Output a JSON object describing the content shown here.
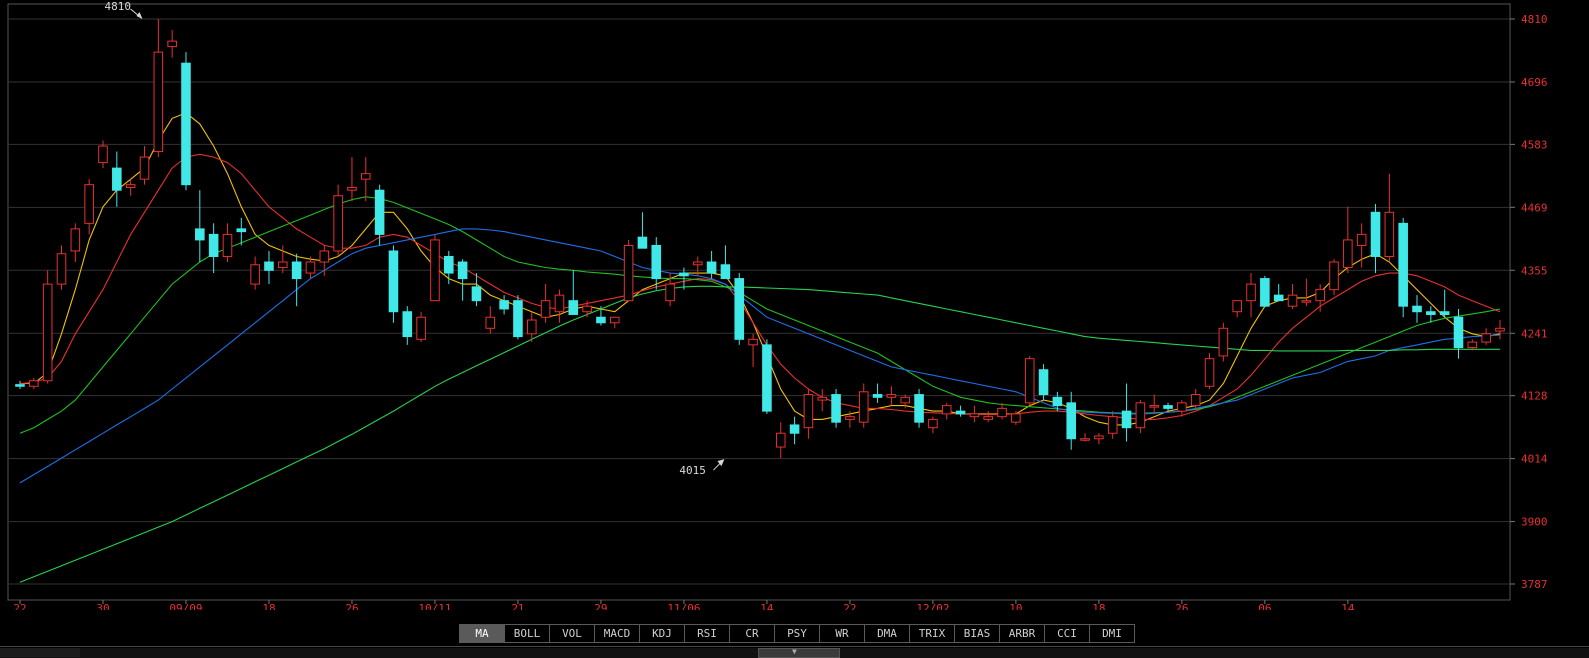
{
  "chart_data": {
    "type": "candlestick",
    "y_ticks": [
      4810,
      4696,
      4583,
      4469,
      4355,
      4241,
      4128,
      4014,
      3900,
      3787
    ],
    "ylim": [
      3787,
      4810
    ],
    "x_ticks": [
      {
        "i": 0,
        "label": "22"
      },
      {
        "i": 6,
        "label": "30"
      },
      {
        "i": 12,
        "label": "09/09"
      },
      {
        "i": 18,
        "label": "18"
      },
      {
        "i": 24,
        "label": "26"
      },
      {
        "i": 30,
        "label": "10/11"
      },
      {
        "i": 36,
        "label": "21"
      },
      {
        "i": 42,
        "label": "29"
      },
      {
        "i": 48,
        "label": "11/06"
      },
      {
        "i": 54,
        "label": "14"
      },
      {
        "i": 60,
        "label": "22"
      },
      {
        "i": 66,
        "label": "12/02"
      },
      {
        "i": 72,
        "label": "10"
      },
      {
        "i": 78,
        "label": "18"
      },
      {
        "i": 84,
        "label": "26"
      },
      {
        "i": 90,
        "label": "06"
      },
      {
        "i": 96,
        "label": "14"
      }
    ],
    "annotations": [
      {
        "label": "4810",
        "index": 9,
        "value": 4810,
        "kind": "high"
      },
      {
        "label": "4015",
        "index": 51,
        "value": 4015,
        "kind": "low"
      }
    ],
    "candles": [
      [
        4148,
        4155,
        4140,
        4145
      ],
      [
        4145,
        4160,
        4140,
        4155
      ],
      [
        4155,
        4355,
        4150,
        4330
      ],
      [
        4330,
        4400,
        4320,
        4385
      ],
      [
        4390,
        4440,
        4370,
        4430
      ],
      [
        4440,
        4520,
        4420,
        4510
      ],
      [
        4550,
        4590,
        4540,
        4580
      ],
      [
        4540,
        4570,
        4470,
        4500
      ],
      [
        4505,
        4520,
        4490,
        4510
      ],
      [
        4520,
        4580,
        4510,
        4560
      ],
      [
        4570,
        4810,
        4560,
        4750
      ],
      [
        4760,
        4790,
        4740,
        4770
      ],
      [
        4730,
        4750,
        4500,
        4510
      ],
      [
        4430,
        4500,
        4370,
        4410
      ],
      [
        4420,
        4440,
        4350,
        4380
      ],
      [
        4380,
        4440,
        4370,
        4420
      ],
      [
        4430,
        4450,
        4400,
        4425
      ],
      [
        4330,
        4380,
        4320,
        4365
      ],
      [
        4370,
        4390,
        4330,
        4355
      ],
      [
        4360,
        4400,
        4350,
        4370
      ],
      [
        4370,
        4385,
        4290,
        4340
      ],
      [
        4350,
        4380,
        4340,
        4370
      ],
      [
        4370,
        4400,
        4345,
        4390
      ],
      [
        4390,
        4510,
        4380,
        4490
      ],
      [
        4500,
        4560,
        4480,
        4505
      ],
      [
        4520,
        4560,
        4480,
        4530
      ],
      [
        4500,
        4510,
        4400,
        4420
      ],
      [
        4390,
        4400,
        4260,
        4280
      ],
      [
        4280,
        4290,
        4220,
        4235
      ],
      [
        4230,
        4280,
        4225,
        4270
      ],
      [
        4300,
        4420,
        4300,
        4410
      ],
      [
        4380,
        4390,
        4330,
        4350
      ],
      [
        4370,
        4375,
        4300,
        4340
      ],
      [
        4325,
        4350,
        4290,
        4300
      ],
      [
        4250,
        4290,
        4240,
        4270
      ],
      [
        4300,
        4310,
        4275,
        4285
      ],
      [
        4300,
        4310,
        4230,
        4235
      ],
      [
        4240,
        4280,
        4225,
        4265
      ],
      [
        4270,
        4330,
        4260,
        4300
      ],
      [
        4280,
        4320,
        4260,
        4310
      ],
      [
        4300,
        4355,
        4280,
        4275
      ],
      [
        4280,
        4300,
        4270,
        4290
      ],
      [
        4270,
        4290,
        4255,
        4260
      ],
      [
        4260,
        4270,
        4250,
        4270
      ],
      [
        4300,
        4410,
        4300,
        4400
      ],
      [
        4415,
        4460,
        4400,
        4395
      ],
      [
        4400,
        4415,
        4320,
        4340
      ],
      [
        4300,
        4350,
        4290,
        4330
      ],
      [
        4350,
        4360,
        4320,
        4345
      ],
      [
        4365,
        4380,
        4345,
        4370
      ],
      [
        4370,
        4390,
        4340,
        4350
      ],
      [
        4365,
        4400,
        4345,
        4340
      ],
      [
        4340,
        4350,
        4220,
        4230
      ],
      [
        4220,
        4240,
        4180,
        4230
      ],
      [
        4220,
        4230,
        4095,
        4100
      ],
      [
        4035,
        4080,
        4015,
        4060
      ],
      [
        4075,
        4090,
        4040,
        4060
      ],
      [
        4070,
        4140,
        4050,
        4130
      ],
      [
        4120,
        4140,
        4100,
        4125
      ],
      [
        4130,
        4140,
        4070,
        4080
      ],
      [
        4085,
        4100,
        4070,
        4090
      ],
      [
        4080,
        4150,
        4070,
        4135
      ],
      [
        4130,
        4150,
        4115,
        4125
      ],
      [
        4125,
        4145,
        4110,
        4130
      ],
      [
        4115,
        4130,
        4105,
        4125
      ],
      [
        4130,
        4140,
        4070,
        4080
      ],
      [
        4070,
        4090,
        4060,
        4085
      ],
      [
        4095,
        4115,
        4085,
        4110
      ],
      [
        4100,
        4110,
        4090,
        4095
      ],
      [
        4090,
        4110,
        4080,
        4095
      ],
      [
        4085,
        4100,
        4080,
        4090
      ],
      [
        4090,
        4115,
        4085,
        4105
      ],
      [
        4080,
        4100,
        4075,
        4095
      ],
      [
        4115,
        4200,
        4110,
        4195
      ],
      [
        4175,
        4185,
        4120,
        4130
      ],
      [
        4125,
        4135,
        4100,
        4110
      ],
      [
        4115,
        4135,
        4030,
        4050
      ],
      [
        4050,
        4060,
        4045,
        4050
      ],
      [
        4050,
        4060,
        4040,
        4055
      ],
      [
        4060,
        4100,
        4050,
        4090
      ],
      [
        4100,
        4150,
        4045,
        4070
      ],
      [
        4070,
        4120,
        4060,
        4115
      ],
      [
        4110,
        4130,
        4095,
        4110
      ],
      [
        4110,
        4115,
        4100,
        4105
      ],
      [
        4100,
        4120,
        4090,
        4115
      ],
      [
        4110,
        4140,
        4105,
        4130
      ],
      [
        4145,
        4205,
        4140,
        4195
      ],
      [
        4200,
        4260,
        4190,
        4250
      ],
      [
        4280,
        4300,
        4270,
        4300
      ],
      [
        4300,
        4350,
        4270,
        4330
      ],
      [
        4340,
        4345,
        4290,
        4290
      ],
      [
        4310,
        4330,
        4300,
        4300
      ],
      [
        4290,
        4330,
        4285,
        4310
      ],
      [
        4300,
        4340,
        4290,
        4300
      ],
      [
        4300,
        4330,
        4280,
        4320
      ],
      [
        4320,
        4375,
        4310,
        4370
      ],
      [
        4360,
        4470,
        4350,
        4410
      ],
      [
        4400,
        4440,
        4360,
        4420
      ],
      [
        4460,
        4475,
        4350,
        4380
      ],
      [
        4380,
        4530,
        4370,
        4460
      ],
      [
        4440,
        4450,
        4270,
        4290
      ],
      [
        4290,
        4310,
        4260,
        4280
      ],
      [
        4280,
        4290,
        4260,
        4275
      ],
      [
        4280,
        4320,
        4270,
        4275
      ],
      [
        4270,
        4285,
        4195,
        4215
      ],
      [
        4215,
        4230,
        4210,
        4225
      ],
      [
        4225,
        4250,
        4220,
        4240
      ],
      [
        4245,
        4265,
        4230,
        4250
      ]
    ],
    "ma_lines": [
      {
        "name": "MA5",
        "color": "#f2c200",
        "values": [
          4150,
          4150,
          4170,
          4240,
          4320,
          4410,
          4470,
          4500,
          4520,
          4540,
          4590,
          4630,
          4640,
          4620,
          4580,
          4530,
          4470,
          4420,
          4400,
          4390,
          4380,
          4375,
          4372,
          4380,
          4400,
          4430,
          4460,
          4460,
          4430,
          4390,
          4360,
          4340,
          4330,
          4330,
          4310,
          4300,
          4290,
          4280,
          4270,
          4275,
          4285,
          4290,
          4285,
          4280,
          4300,
          4320,
          4330,
          4340,
          4350,
          4350,
          4350,
          4345,
          4310,
          4260,
          4200,
          4140,
          4100,
          4085,
          4085,
          4090,
          4095,
          4100,
          4105,
          4110,
          4110,
          4105,
          4100,
          4100,
          4095,
          4095,
          4095,
          4095,
          4095,
          4110,
          4120,
          4115,
          4105,
          4090,
          4080,
          4075,
          4075,
          4080,
          4090,
          4100,
          4105,
          4110,
          4120,
          4150,
          4200,
          4250,
          4290,
          4300,
          4305,
          4305,
          4315,
          4340,
          4360,
          4375,
          4385,
          4370,
          4345,
          4320,
          4295,
          4270,
          4250,
          4240,
          4235,
          4240
        ]
      },
      {
        "name": "MA10",
        "color": "#e83030",
        "values": [
          4150,
          4152,
          4160,
          4190,
          4240,
          4280,
          4320,
          4370,
          4420,
          4460,
          4500,
          4540,
          4560,
          4565,
          4560,
          4550,
          4530,
          4500,
          4470,
          4450,
          4430,
          4415,
          4400,
          4395,
          4395,
          4400,
          4415,
          4420,
          4415,
          4400,
          4385,
          4370,
          4360,
          4345,
          4330,
          4315,
          4305,
          4295,
          4288,
          4285,
          4290,
          4295,
          4300,
          4305,
          4310,
          4318,
          4325,
          4330,
          4335,
          4340,
          4338,
          4330,
          4300,
          4260,
          4220,
          4185,
          4160,
          4140,
          4125,
          4115,
          4110,
          4105,
          4105,
          4103,
          4100,
          4098,
          4097,
          4096,
          4095,
          4094,
          4094,
          4094,
          4095,
          4098,
          4100,
          4100,
          4098,
          4095,
          4092,
          4090,
          4088,
          4085,
          4085,
          4088,
          4092,
          4100,
          4110,
          4125,
          4140,
          4165,
          4195,
          4225,
          4250,
          4270,
          4290,
          4305,
          4320,
          4335,
          4345,
          4350,
          4350,
          4345,
          4335,
          4325,
          4310,
          4300,
          4290,
          4280
        ]
      },
      {
        "name": "MA20",
        "color": "#20c020",
        "values": [
          4060,
          4070,
          4085,
          4100,
          4120,
          4150,
          4180,
          4210,
          4240,
          4270,
          4300,
          4330,
          4350,
          4370,
          4385,
          4395,
          4405,
          4415,
          4425,
          4435,
          4445,
          4455,
          4465,
          4475,
          4483,
          4488,
          4485,
          4478,
          4468,
          4458,
          4448,
          4438,
          4425,
          4410,
          4395,
          4380,
          4370,
          4365,
          4360,
          4357,
          4355,
          4352,
          4350,
          4348,
          4345,
          4343,
          4341,
          4340,
          4340,
          4338,
          4335,
          4325,
          4315,
          4300,
          4285,
          4275,
          4265,
          4255,
          4245,
          4235,
          4225,
          4215,
          4205,
          4190,
          4175,
          4160,
          4145,
          4135,
          4125,
          4120,
          4115,
          4112,
          4110,
          4108,
          4106,
          4104,
          4102,
          4100,
          4098,
          4097,
          4096,
          4096,
          4097,
          4098,
          4100,
          4103,
          4108,
          4115,
          4125,
          4135,
          4145,
          4155,
          4165,
          4175,
          4185,
          4195,
          4205,
          4215,
          4225,
          4235,
          4245,
          4255,
          4262,
          4268,
          4272,
          4276,
          4280,
          4285
        ]
      },
      {
        "name": "MA30",
        "color": "#1e6fe8",
        "values": [
          3970,
          3985,
          4000,
          4015,
          4030,
          4045,
          4060,
          4075,
          4090,
          4105,
          4120,
          4140,
          4160,
          4180,
          4200,
          4220,
          4240,
          4260,
          4280,
          4300,
          4320,
          4340,
          4355,
          4370,
          4385,
          4395,
          4400,
          4405,
          4410,
          4415,
          4420,
          4425,
          4430,
          4430,
          4428,
          4425,
          4420,
          4415,
          4410,
          4405,
          4400,
          4395,
          4390,
          4380,
          4370,
          4360,
          4355,
          4350,
          4348,
          4345,
          4340,
          4330,
          4310,
          4290,
          4270,
          4260,
          4250,
          4240,
          4230,
          4220,
          4210,
          4200,
          4190,
          4180,
          4175,
          4170,
          4165,
          4160,
          4155,
          4150,
          4145,
          4140,
          4135,
          4125,
          4115,
          4105,
          4100,
          4098,
          4097,
          4096,
          4095,
          4095,
          4096,
          4098,
          4100,
          4105,
          4110,
          4115,
          4120,
          4130,
          4140,
          4150,
          4160,
          4165,
          4170,
          4180,
          4190,
          4195,
          4200,
          4210,
          4215,
          4220,
          4225,
          4230,
          4232,
          4235,
          4236,
          4238
        ]
      },
      {
        "name": "MA60",
        "color": "#28d050",
        "values": [
          3790,
          3800,
          3810,
          3820,
          3830,
          3840,
          3850,
          3860,
          3870,
          3880,
          3890,
          3900,
          3912,
          3924,
          3936,
          3948,
          3960,
          3972,
          3984,
          3996,
          4008,
          4020,
          4032,
          4045,
          4058,
          4072,
          4086,
          4100,
          4115,
          4130,
          4145,
          4158,
          4170,
          4182,
          4194,
          4206,
          4218,
          4230,
          4242,
          4254,
          4265,
          4275,
          4285,
          4295,
          4305,
          4312,
          4318,
          4322,
          4325,
          4326,
          4326,
          4325,
          4325,
          4324,
          4323,
          4322,
          4321,
          4320,
          4318,
          4316,
          4314,
          4312,
          4310,
          4305,
          4300,
          4295,
          4290,
          4285,
          4280,
          4275,
          4270,
          4265,
          4260,
          4255,
          4250,
          4245,
          4240,
          4235,
          4232,
          4230,
          4228,
          4226,
          4224,
          4222,
          4220,
          4218,
          4216,
          4214,
          4212,
          4210,
          4210,
          4209,
          4209,
          4209,
          4209,
          4209,
          4210,
          4210,
          4210,
          4210,
          4211,
          4211,
          4212,
          4212,
          4212,
          4212,
          4212,
          4212
        ]
      }
    ]
  },
  "indicators": {
    "items": [
      "MA",
      "BOLL",
      "VOL",
      "MACD",
      "KDJ",
      "RSI",
      "CR",
      "PSY",
      "WR",
      "DMA",
      "TRIX",
      "BIAS",
      "ARBR",
      "CCI",
      "DMI"
    ],
    "active": "MA"
  },
  "colors": {
    "up": "#e83030",
    "down": "#40e8e8",
    "axis_label": "#e83030",
    "grid": "#333333",
    "annotation": "#d8d8d8"
  }
}
